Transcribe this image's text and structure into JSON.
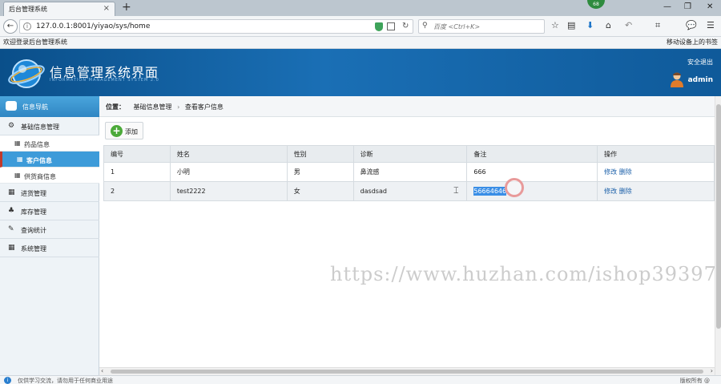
{
  "browser": {
    "tab_title": "后台管理系统",
    "tab_close": "×",
    "new_tab": "+",
    "badge": "68",
    "url": "127.0.0.1:8001/yiyao/sys/home",
    "search_placeholder": "百度 <Ctrl+K>",
    "bookmark": "欢迎登录后台管理系统",
    "bookmark_right": "移动设备上的书签"
  },
  "header": {
    "title": "信息管理系统界面",
    "subtitle": "INFORMATION MANAGEMENT SYSTEM 2.0",
    "logout": "安全退出",
    "user": "admin"
  },
  "sidebar": {
    "head": "信息导航",
    "items": [
      {
        "label": "基础信息管理",
        "icon": "gears-icon"
      },
      {
        "label": "药品信息",
        "icon": "grid-icon"
      },
      {
        "label": "客户信息",
        "icon": "grid-icon",
        "active": true
      },
      {
        "label": "供货商信息",
        "icon": "grid-icon"
      },
      {
        "label": "进货管理",
        "icon": "calendar-icon"
      },
      {
        "label": "库存管理",
        "icon": "sitemap-icon"
      },
      {
        "label": "查询统计",
        "icon": "edit-icon"
      },
      {
        "label": "系统管理",
        "icon": "calendar-icon"
      }
    ]
  },
  "breadcrumb": {
    "label": "位置：",
    "level1": "基础信息管理",
    "sep": "›",
    "level2": "查看客户信息"
  },
  "toolbar": {
    "add_label": "添加"
  },
  "table": {
    "columns": [
      "编号",
      "姓名",
      "性别",
      "诊断",
      "备注",
      "操作"
    ],
    "rows": [
      {
        "id": "1",
        "name": "小明",
        "gender": "男",
        "diagnosis": "鼻流感",
        "note": "666",
        "edit": "修改",
        "delete": "删除"
      },
      {
        "id": "2",
        "name": "test2222",
        "gender": "女",
        "diagnosis": "dasdsad",
        "note": "56664646",
        "edit": "修改",
        "delete": "删除"
      }
    ]
  },
  "watermark": "https://www.huzhan.com/ishop39397",
  "status": {
    "left": "仅供学习交流，请勿用于任何商业用途",
    "right": "版权所有 @"
  },
  "colors": {
    "header_blue": "#1a6fb5",
    "sidebar_active": "#3d9bd9",
    "link": "#1a5fa8",
    "add_green": "#4caa3a"
  }
}
